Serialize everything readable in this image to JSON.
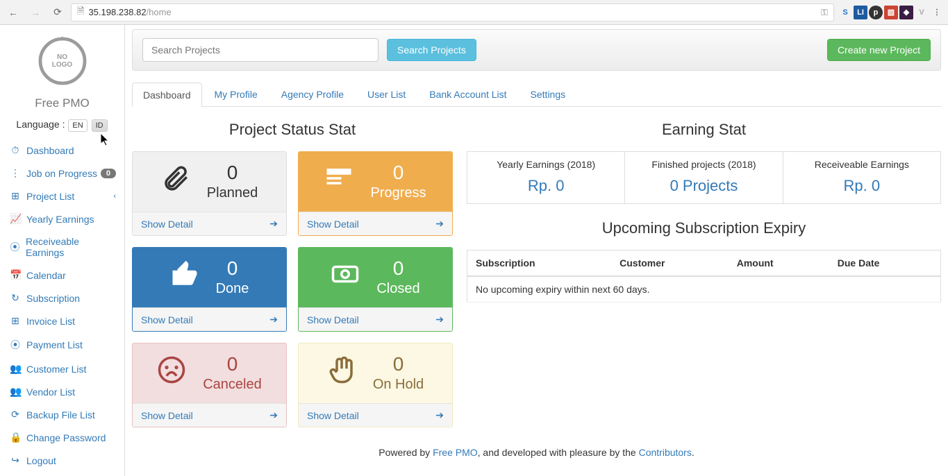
{
  "browser": {
    "url_host": "35.198.238.82",
    "url_path": "/home"
  },
  "sidebar": {
    "brand": "Free PMO",
    "no_logo_line1": "NO",
    "no_logo_line2": "LOGO",
    "lang_label": "Language :",
    "lang_en": "EN",
    "lang_id": "ID",
    "items": [
      {
        "icon": "⏱",
        "label": "Dashboard"
      },
      {
        "icon": "⋮",
        "label": "Job on Progress",
        "badge": "0"
      },
      {
        "icon": "⊞",
        "label": "Project List",
        "chevron": true
      },
      {
        "icon": "📈",
        "label": "Yearly Earnings"
      },
      {
        "icon": "⦿",
        "label": "Receiveable Earnings"
      },
      {
        "icon": "📅",
        "label": "Calendar"
      },
      {
        "icon": "↻",
        "label": "Subscription"
      },
      {
        "icon": "⊞",
        "label": "Invoice List"
      },
      {
        "icon": "⦿",
        "label": "Payment List"
      },
      {
        "icon": "👥",
        "label": "Customer List"
      },
      {
        "icon": "👥",
        "label": "Vendor List"
      },
      {
        "icon": "⟳",
        "label": "Backup File List"
      },
      {
        "icon": "🔒",
        "label": "Change Password"
      },
      {
        "icon": "↪",
        "label": "Logout"
      }
    ]
  },
  "toolbar": {
    "search_placeholder": "Search Projects",
    "search_btn": "Search Projects",
    "create_btn": "Create new Project"
  },
  "tabs": [
    "Dashboard",
    "My Profile",
    "Agency Profile",
    "User List",
    "Bank Account List",
    "Settings"
  ],
  "left": {
    "title": "Project Status Stat",
    "show_detail": "Show Detail",
    "cards": [
      {
        "num": "0",
        "label": "Planned"
      },
      {
        "num": "0",
        "label": "Progress"
      },
      {
        "num": "0",
        "label": "Done"
      },
      {
        "num": "0",
        "label": "Closed"
      },
      {
        "num": "0",
        "label": "Canceled"
      },
      {
        "num": "0",
        "label": "On Hold"
      }
    ]
  },
  "right": {
    "earning_title": "Earning Stat",
    "cells": [
      {
        "title": "Yearly Earnings (2018)",
        "value": "Rp. 0"
      },
      {
        "title": "Finished projects (2018)",
        "value": "0 Projects"
      },
      {
        "title": "Receiveable Earnings",
        "value": "Rp. 0"
      }
    ],
    "sub_title": "Upcoming Subscription Expiry",
    "table": {
      "headers": [
        "Subscription",
        "Customer",
        "Amount",
        "Due Date"
      ],
      "empty": "No upcoming expiry within next 60 days."
    }
  },
  "footer": {
    "pre": "Powered by ",
    "link1": "Free PMO",
    "mid": ", and developed with pleasure by the ",
    "link2": "Contributors",
    "post": "."
  }
}
